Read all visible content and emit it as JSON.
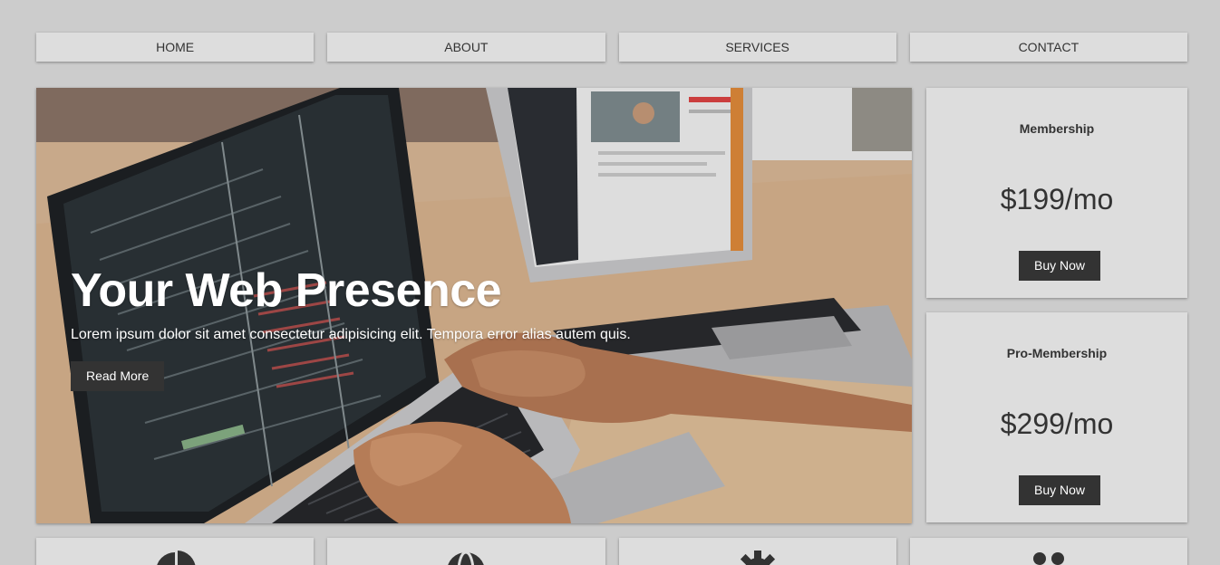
{
  "nav": {
    "items": [
      {
        "label": "HOME"
      },
      {
        "label": "ABOUT"
      },
      {
        "label": "SERVICES"
      },
      {
        "label": "CONTACT"
      }
    ]
  },
  "showcase": {
    "title": "Your Web Presence",
    "text": "Lorem ipsum dolor sit amet consectetur adipisicing elit. Tempora error alias autem quis.",
    "button_label": "Read More",
    "image": "laptops-on-desk-photo"
  },
  "plans": [
    {
      "name": "Membership",
      "price": "$199/mo",
      "button_label": "Buy Now"
    },
    {
      "name": "Pro-Membership",
      "price": "$299/mo",
      "button_label": "Buy Now"
    }
  ],
  "boxes": [
    {
      "icon": "pie-chart-icon"
    },
    {
      "icon": "globe-icon"
    },
    {
      "icon": "cog-icon"
    },
    {
      "icon": "users-icon"
    }
  ],
  "colors": {
    "background": "#cccccc",
    "card": "#dddddd",
    "button": "#333333",
    "text": "#333333"
  }
}
